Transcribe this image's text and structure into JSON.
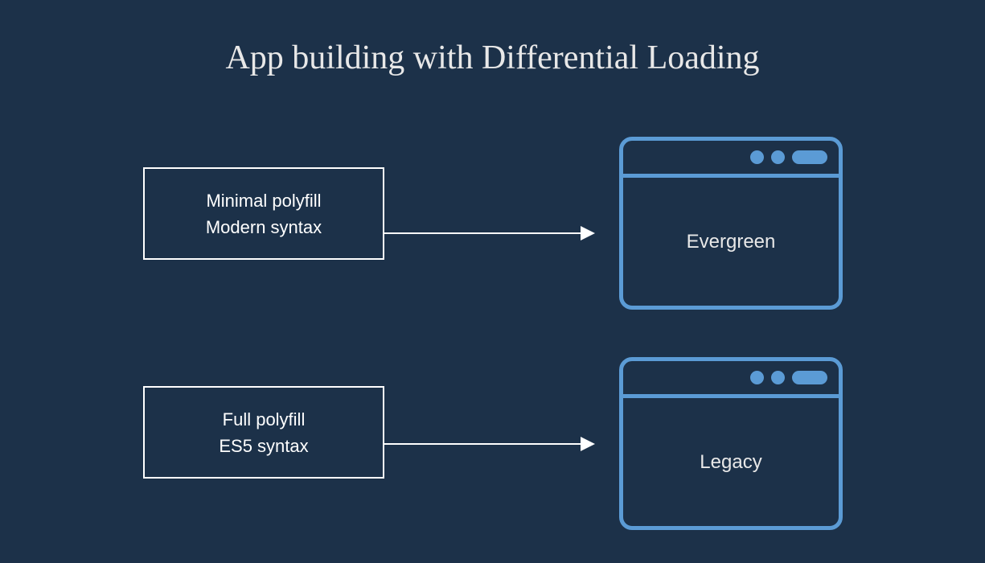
{
  "title": "App building with Differential Loading",
  "flows": [
    {
      "source": {
        "line1": "Minimal polyfill",
        "line2": "Modern syntax"
      },
      "target": {
        "label": "Evergreen"
      }
    },
    {
      "source": {
        "line1": "Full polyfill",
        "line2": "ES5 syntax"
      },
      "target": {
        "label": "Legacy"
      }
    }
  ],
  "colors": {
    "background": "#1c3149",
    "text": "#e8e8e8",
    "box_border": "#ffffff",
    "browser_accent": "#5b9bd5"
  }
}
